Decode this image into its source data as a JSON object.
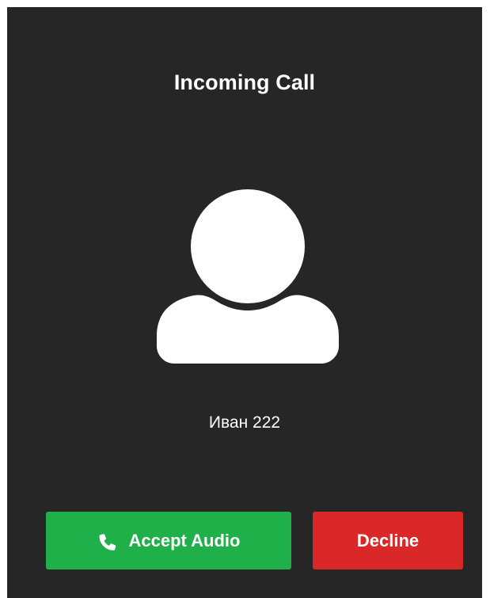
{
  "dialog": {
    "title": "Incoming Call",
    "caller_name": "Иван 222",
    "avatar_icon": "user-avatar-icon"
  },
  "actions": {
    "accept_label": "Accept Audio",
    "accept_icon": "phone-icon",
    "decline_label": "Decline"
  },
  "colors": {
    "background": "#262626",
    "text": "#ffffff",
    "accept": "#1fb04a",
    "decline": "#da2727"
  }
}
